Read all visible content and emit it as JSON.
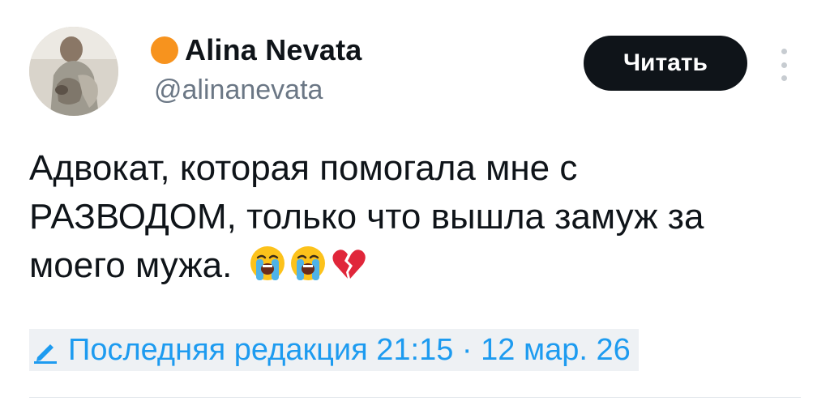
{
  "author": {
    "display_name": "Alina Nevata",
    "handle": "@alinanevata",
    "status_color": "#f7931e",
    "avatar_icon": "profile-photo"
  },
  "follow_button": {
    "label": "Читать"
  },
  "more_menu": {
    "icon": "more-vertical-icon"
  },
  "tweet": {
    "text": "Адвокат, которая помогала мне с РАЗВОДОМ, только что вышла замуж за моего мужа.",
    "emojis": [
      "loudly-crying-face",
      "loudly-crying-face",
      "broken-heart"
    ]
  },
  "edit_info": {
    "icon": "pencil-icon",
    "text": "Последняя редакция 21:15 · 12 мар. 26",
    "link_color": "#1d9bf0"
  }
}
